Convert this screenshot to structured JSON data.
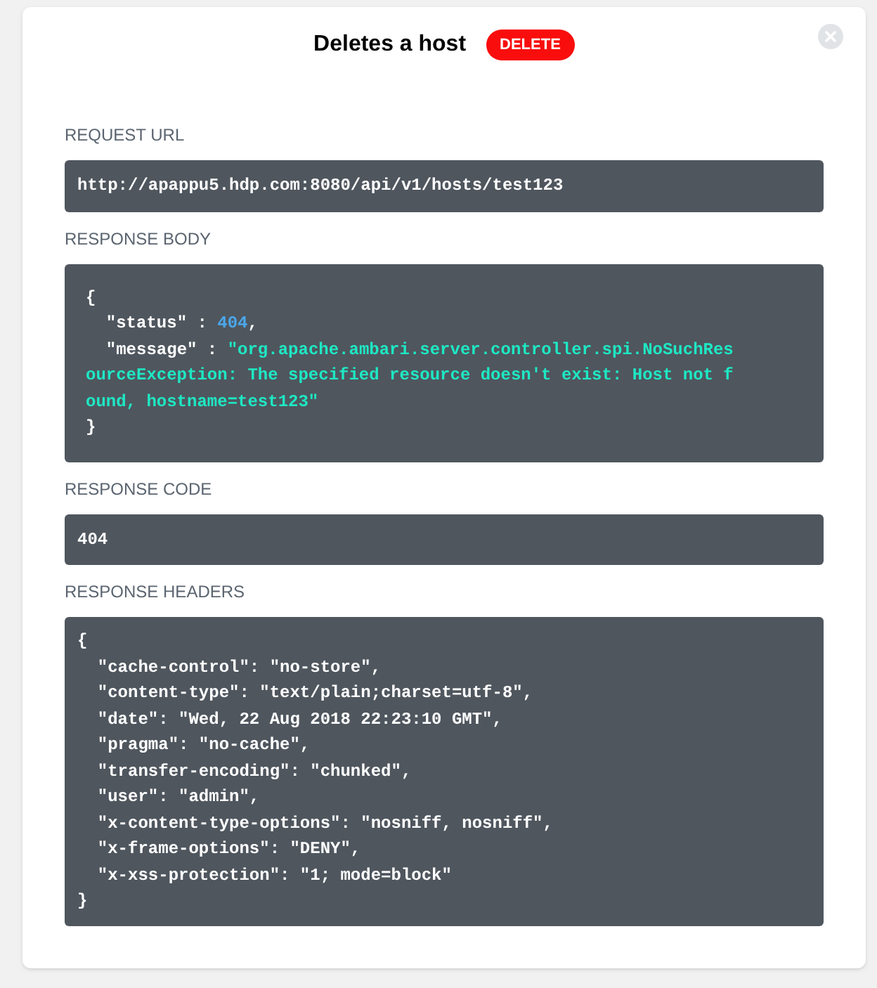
{
  "title": "Deletes a host",
  "method": {
    "label": "DELETE",
    "kind": "delete"
  },
  "sections": [
    {
      "label": "REQUEST URL",
      "kind": "single",
      "lines": [
        [
          {
            "kind": "plain",
            "text": "http://apappu5.hdp.com:8080/api/v1/hosts/test123"
          }
        ]
      ]
    },
    {
      "label": "RESPONSE BODY",
      "kind": "block",
      "lines": [
        [
          {
            "kind": "plain",
            "text": "{"
          }
        ],
        [
          {
            "kind": "plain",
            "text": "  \"status\" : "
          },
          {
            "kind": "number",
            "text": "404"
          },
          {
            "kind": "plain",
            "text": ","
          }
        ],
        [
          {
            "kind": "plain",
            "text": "  \"message\" : "
          },
          {
            "kind": "string",
            "text": "\"org.apache.ambari.server.controller.spi.NoSuchResourceException: The specified resource doesn't exist: Host not found, hostname=test123\""
          }
        ],
        [
          {
            "kind": "plain",
            "text": "}"
          }
        ]
      ]
    },
    {
      "label": "RESPONSE CODE",
      "kind": "single",
      "lines": [
        [
          {
            "kind": "plain",
            "text": "404"
          }
        ]
      ]
    },
    {
      "label": "RESPONSE HEADERS",
      "kind": "headers",
      "lines": [
        [
          {
            "kind": "plain",
            "text": "{"
          }
        ],
        [
          {
            "kind": "plain",
            "text": "  \"cache-control\": \"no-store\","
          }
        ],
        [
          {
            "kind": "plain",
            "text": "  \"content-type\": \"text/plain;charset=utf-8\","
          }
        ],
        [
          {
            "kind": "plain",
            "text": "  \"date\": \"Wed, 22 Aug 2018 22:23:10 GMT\","
          }
        ],
        [
          {
            "kind": "plain",
            "text": "  \"pragma\": \"no-cache\","
          }
        ],
        [
          {
            "kind": "plain",
            "text": "  \"transfer-encoding\": \"chunked\","
          }
        ],
        [
          {
            "kind": "plain",
            "text": "  \"user\": \"admin\","
          }
        ],
        [
          {
            "kind": "plain",
            "text": "  \"x-content-type-options\": \"nosniff, nosniff\","
          }
        ],
        [
          {
            "kind": "plain",
            "text": "  \"x-frame-options\": \"DENY\","
          }
        ],
        [
          {
            "kind": "plain",
            "text": "  \"x-xss-protection\": \"1; mode=block\""
          }
        ],
        [
          {
            "kind": "plain",
            "text": "}"
          }
        ]
      ]
    }
  ]
}
